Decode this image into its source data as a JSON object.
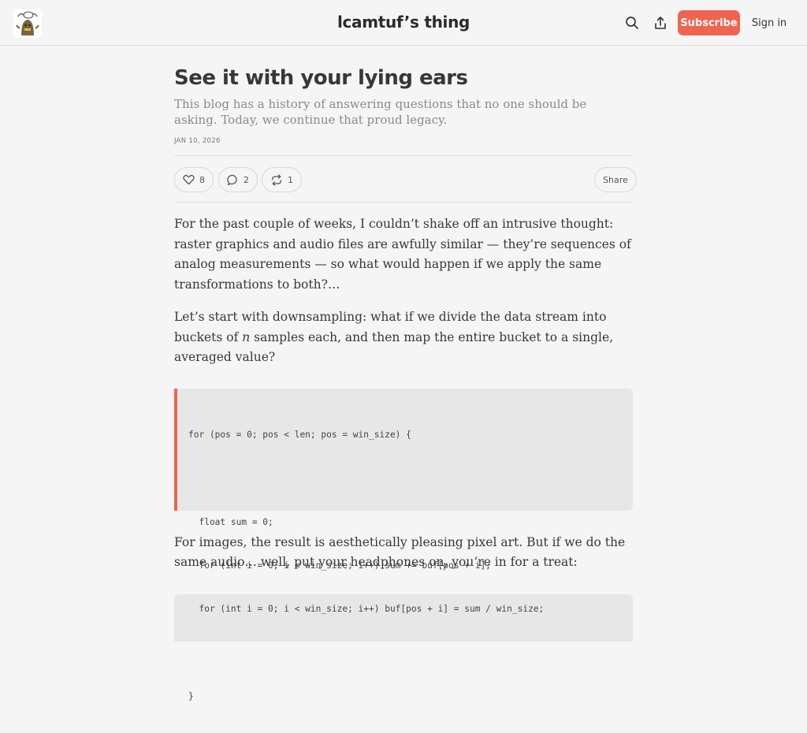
{
  "header": {
    "site_title": "lcamtuf’s thing",
    "subscribe_label": "Subscribe",
    "signin_label": "Sign in",
    "icons": [
      "logo-icon",
      "search-icon",
      "share-icon"
    ]
  },
  "post": {
    "title": "See it with your lying ears",
    "subtitle": "This blog has a history of answering questions that no one should be asking. Today, we continue that proud legacy.",
    "date": "JAN 10, 2026"
  },
  "actions": {
    "likes": "8",
    "comments": "2",
    "restacks": "1",
    "share_label": "Share"
  },
  "body": {
    "p1": "For the past couple of weeks, I couldn’t shake off an intrusive thought: raster graphics and audio files are awfully similar — they’re sequences of analog measurements — so what would happen if we apply the same transformations to both?…",
    "p2_before": "Let’s start with downsampling: what if we divide the data stream into buckets of ",
    "p2_var": "n",
    "p2_after": " samples each, and then map the entire bucket to a single, averaged value?",
    "code": [
      "for (pos = 0; pos < len; pos = win_size) {",
      "",
      "  float sum = 0;",
      "  for (int i = 0; i < win_size; i++) sum += buf[pos + i];",
      "  for (int i = 0; i < win_size; i++) buf[pos + i] = sum / win_size;",
      "",
      "}"
    ],
    "p3": "For images, the result is aesthetically pleasing pixel art. But if we do the same audio… well, put your headphones on, you’re in for a treat:"
  },
  "colors": {
    "accent": "#f0644f",
    "background": "#f5f5f5",
    "code_bg": "#e7e7e7"
  }
}
